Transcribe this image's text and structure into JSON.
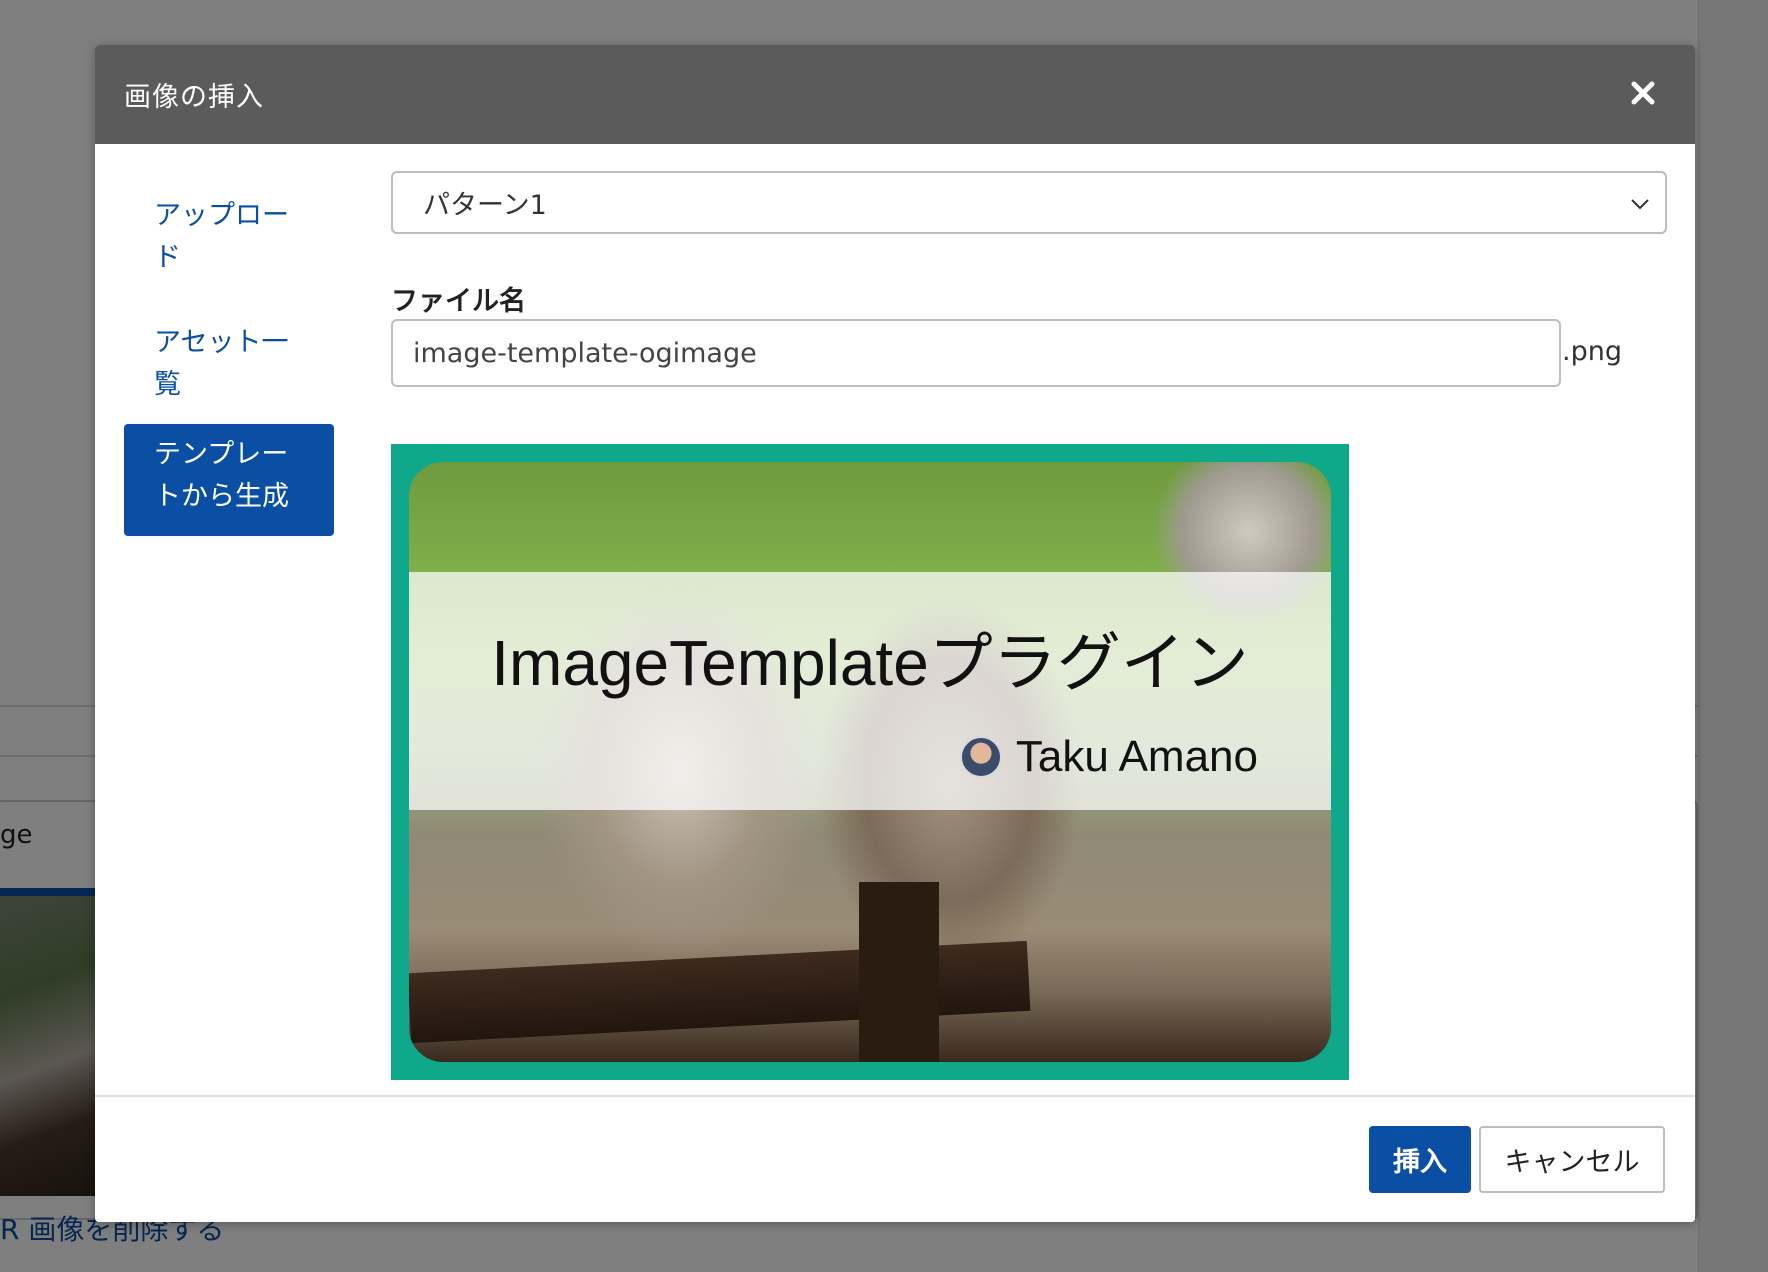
{
  "background": {
    "card_text": "ge",
    "delete_link": "R 画像を削除する"
  },
  "modal": {
    "title": "画像の挿入",
    "close_icon": "close-icon"
  },
  "sidebar": {
    "items": [
      {
        "label": "アップロード",
        "active": false
      },
      {
        "label": "アセット一覧",
        "active": false
      },
      {
        "label": "テンプレートから生成",
        "active": true
      }
    ]
  },
  "pattern_select": {
    "value": "パターン1"
  },
  "filename": {
    "label": "ファイル名",
    "value": "image-template-ogimage",
    "extension": ".png"
  },
  "preview": {
    "title": "ImageTemplateプラグイン",
    "author": "Taku Amano",
    "frame_color": "#0fa88b"
  },
  "footer": {
    "insert_label": "挿入",
    "cancel_label": "キャンセル"
  },
  "colors": {
    "accent": "#0a4fa3",
    "header_bg": "#5b5b5b"
  }
}
